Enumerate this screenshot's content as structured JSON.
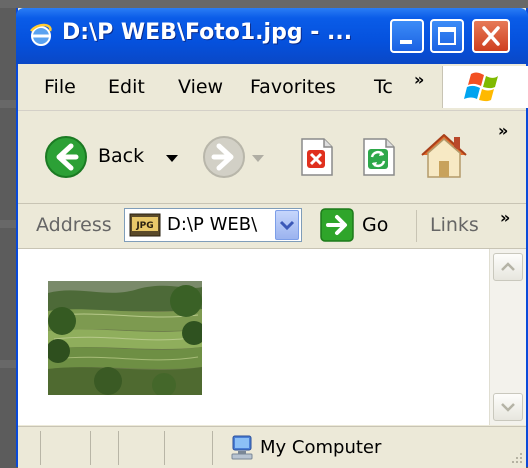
{
  "window": {
    "title": "D:\\P WEB\\Foto1.jpg - ..."
  },
  "menu": {
    "items": [
      {
        "label": "File"
      },
      {
        "label": "Edit"
      },
      {
        "label": "View"
      },
      {
        "label": "Favorites"
      },
      {
        "label": "Tc"
      }
    ],
    "more_chevron": "»"
  },
  "toolbar": {
    "back_label": "Back",
    "more_chevron": "»"
  },
  "address": {
    "label": "Address",
    "value": "D:\\P WEB\\",
    "file_icon_text": "JPG",
    "go_label": "Go",
    "links_label": "Links",
    "more_chevron": "»"
  },
  "status": {
    "zone_label": "My Computer"
  },
  "colors": {
    "titlebar": "#0551dd",
    "chrome": "#ece9d8",
    "close_button": "#cf3f1f",
    "go_green": "#2fa52a",
    "back_green": "#2ca036"
  }
}
